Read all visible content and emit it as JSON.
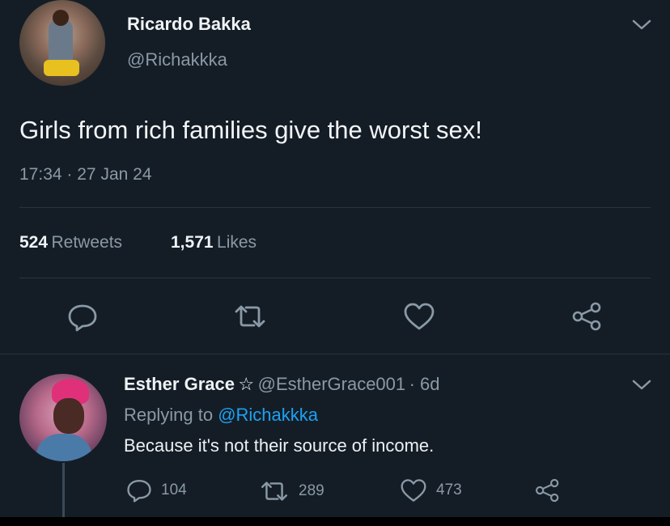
{
  "tweet": {
    "author_name": "Ricardo Bakka",
    "author_handle": "@Richakkka",
    "text": "Girls from rich families give the worst sex!",
    "time": "17:34",
    "date_sep": "·",
    "date": "27 Jan 24",
    "retweets_count": "524",
    "retweets_label": "Retweets",
    "likes_count": "1,571",
    "likes_label": "Likes"
  },
  "reply": {
    "author_name": "Esther Grace",
    "star": "☆",
    "author_handle": "@EstherGrace001",
    "age": "· 6d",
    "replying_prefix": "Replying to",
    "replying_handle": "@Richakkka",
    "text": "Because it's not their source of income.",
    "reply_count": "104",
    "retweet_count": "289",
    "like_count": "473"
  },
  "icons": {
    "chevron": "chevron-down-icon",
    "reply": "comment-icon",
    "retweet": "retweet-icon",
    "like": "heart-icon",
    "share": "share-icon"
  },
  "colors": {
    "background": "#141d26",
    "link": "#1da1f2",
    "muted": "#8a99a6"
  }
}
